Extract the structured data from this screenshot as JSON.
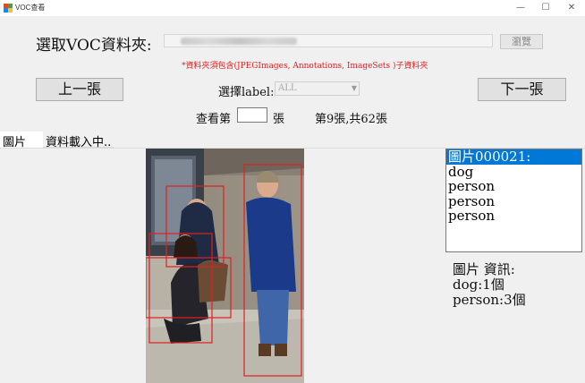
{
  "window": {
    "title": "VOC查看",
    "minimize": "—",
    "maximize": "☐",
    "close": "✕"
  },
  "top": {
    "folder_label": "選取VOC資料夾:",
    "browse_button": "瀏覽",
    "hint": "*資料夾須包含(JPEGImages, Annotations, ImageSets )子資料夾"
  },
  "nav": {
    "prev_button": "上一張",
    "next_button": "下一張",
    "label_select_caption": "選擇label:",
    "label_select_value": "ALL",
    "view_label": "查看第",
    "page_input_value": "",
    "page_suffix": "張",
    "position_text": "第9張,共62張"
  },
  "tabs": [
    {
      "label": "圖片"
    },
    {
      "label": "資料載入中.."
    }
  ],
  "objects_list": {
    "items": [
      "圖片000021:",
      "dog",
      "person",
      "person",
      "person"
    ],
    "selected_index": 0
  },
  "info": {
    "title": "圖片 資訊:",
    "lines": [
      "dog:1個",
      "person:3個"
    ]
  },
  "colors": {
    "bbox": "#e02020",
    "selection": "#0078d7",
    "hint_text": "#e02020"
  }
}
